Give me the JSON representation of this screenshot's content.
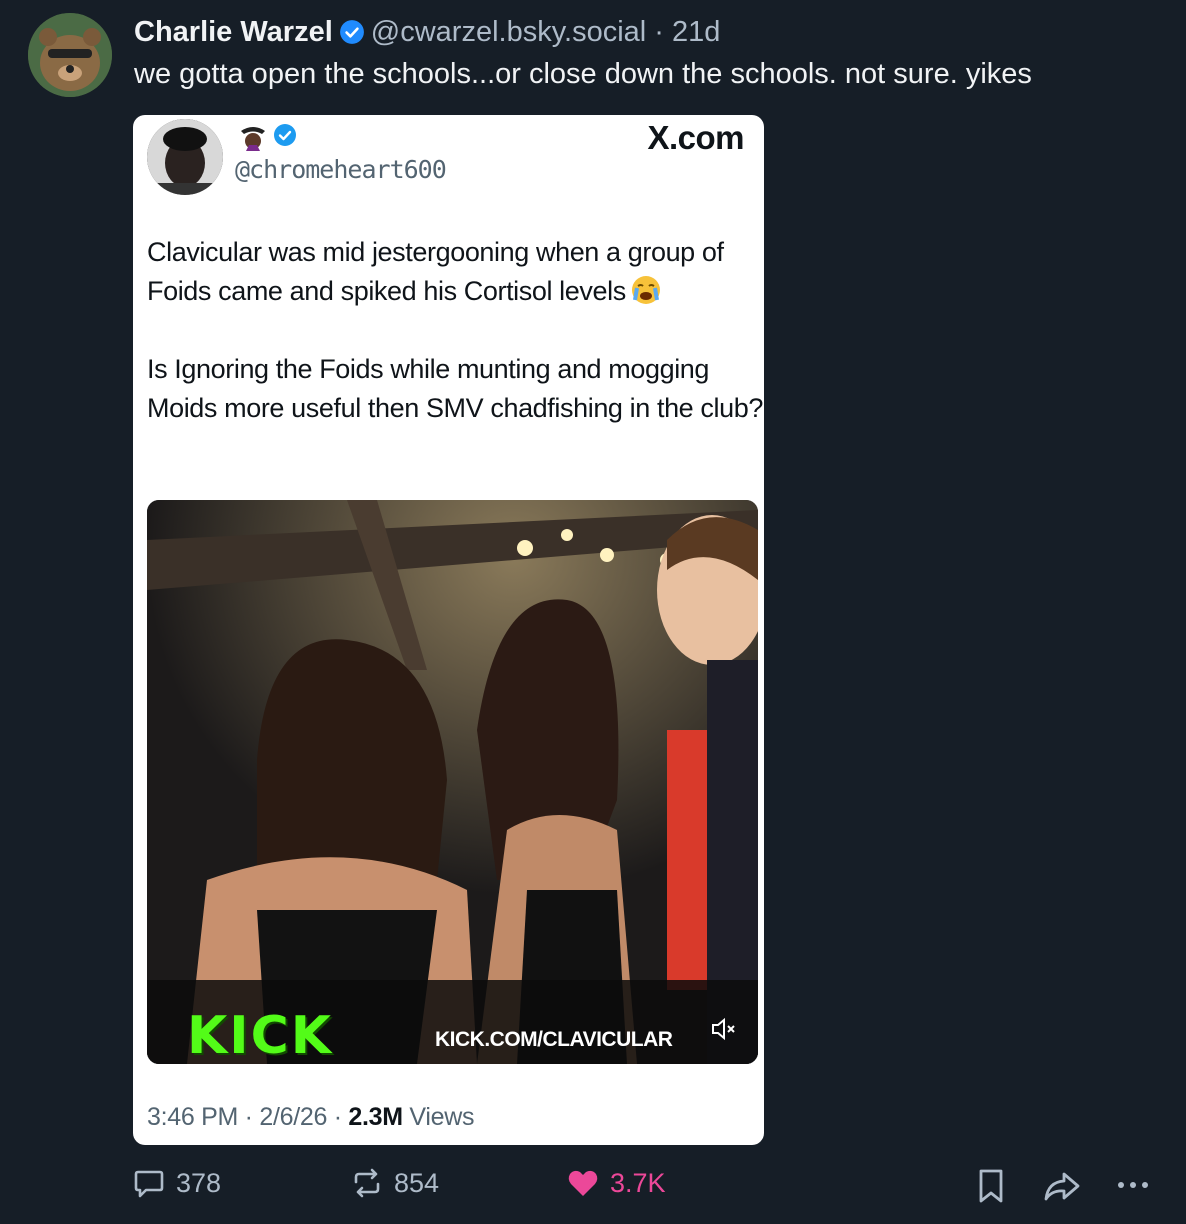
{
  "post": {
    "author_name": "Charlie Warzel",
    "handle": "@cwarzel.bsky.social",
    "separator": "·",
    "time_ago": "21d",
    "text": "we gotta open the schools...or close down the schools. not sure. yikes",
    "avatar_icon": "bear-avatar",
    "verified_icon": "verified-badge-icon"
  },
  "embed": {
    "handle": "@chromeheart600",
    "source": "X.com",
    "body_paragraphs": [
      "Clavicular was mid jestergooning when a group of Foids came and spiked his Cortisol levels",
      "Is Ignoring the Foids while munting and mogging Moids more useful then SMV chadfishing in the club?"
    ],
    "media": {
      "logo_text": "KICK",
      "url_text": "KICK.COM/CLAVICULAR",
      "accent_color": "#53fc18"
    },
    "meta_time": "3:46 PM",
    "meta_sep1": " · ",
    "meta_date": "2/6/26",
    "meta_sep2": " · ",
    "views_count": "2.3M",
    "views_label": " Views"
  },
  "actions": {
    "replies": "378",
    "reposts": "854",
    "likes": "3.7K",
    "like_color": "#ec4899"
  }
}
